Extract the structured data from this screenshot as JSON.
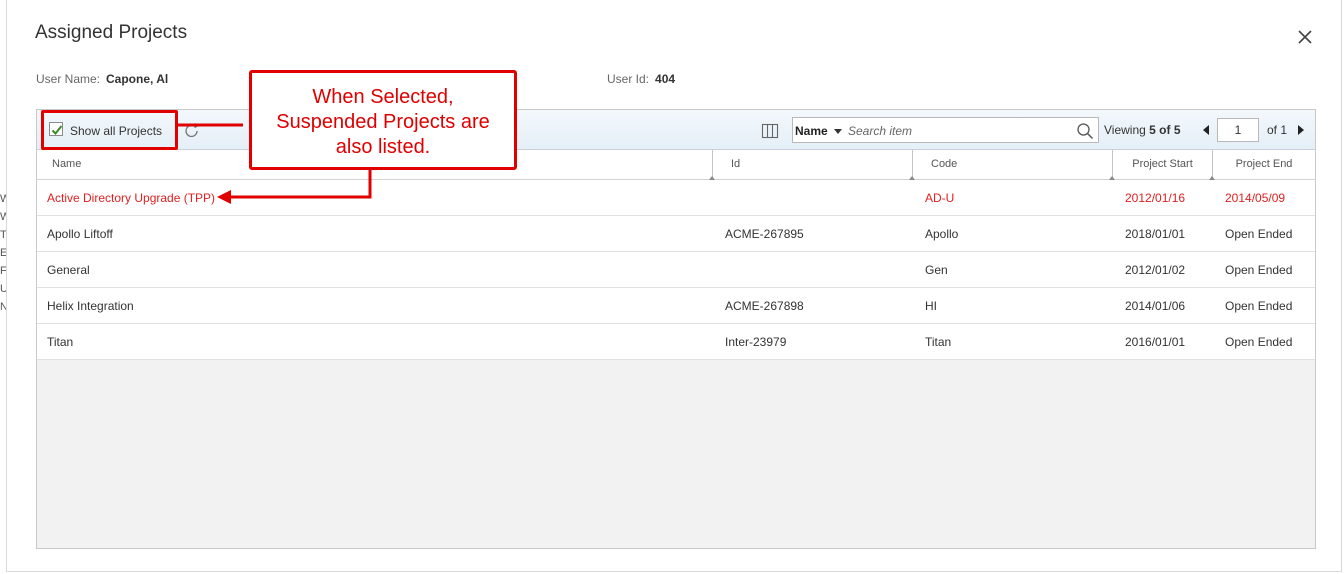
{
  "background_letters": [
    "W",
    "W",
    "T",
    "E",
    "F",
    "U",
    "N"
  ],
  "dialog": {
    "title": "Assigned Projects",
    "close_icon": "close-icon"
  },
  "user": {
    "name_label": "User Name:",
    "name_value": "Capone, Al",
    "id_label": "User Id:",
    "id_value": "404"
  },
  "toolbar": {
    "show_all_label": "Show all Projects",
    "show_all_checked": true,
    "refresh_icon": "refresh-icon",
    "columns_icon": "columns-icon",
    "search_field": "Name",
    "search_placeholder": "Search item",
    "search_icon": "search-icon",
    "viewing_label": "Viewing",
    "viewing_range": "5 of 5",
    "page_value": "1",
    "page_of": "of 1"
  },
  "columns": [
    "Name",
    "Id",
    "Code",
    "Project Start",
    "Project End"
  ],
  "rows": [
    {
      "name": "Active Directory Upgrade (TPP)",
      "id": "",
      "code": "AD-U",
      "start": "2012/01/16",
      "end": "2014/05/09",
      "suspended": true
    },
    {
      "name": "Apollo Liftoff",
      "id": "ACME-267895",
      "code": "Apollo",
      "start": "2018/01/01",
      "end": "Open Ended",
      "suspended": false
    },
    {
      "name": "General",
      "id": "",
      "code": "Gen",
      "start": "2012/01/02",
      "end": "Open Ended",
      "suspended": false
    },
    {
      "name": "Helix Integration",
      "id": "ACME-267898",
      "code": "HI",
      "start": "2014/01/06",
      "end": "Open Ended",
      "suspended": false
    },
    {
      "name": "Titan",
      "id": "Inter-23979",
      "code": "Titan",
      "start": "2016/01/01",
      "end": "Open Ended",
      "suspended": false
    }
  ],
  "annotation": {
    "lines": [
      "When Selected,",
      "Suspended Projects are",
      "also listed."
    ],
    "color": "#e00000"
  },
  "colors": {
    "suspended_text": "#e02020",
    "toolbar_bg": "#e9f2f9",
    "grid_empty_bg": "#f2f2f2"
  }
}
